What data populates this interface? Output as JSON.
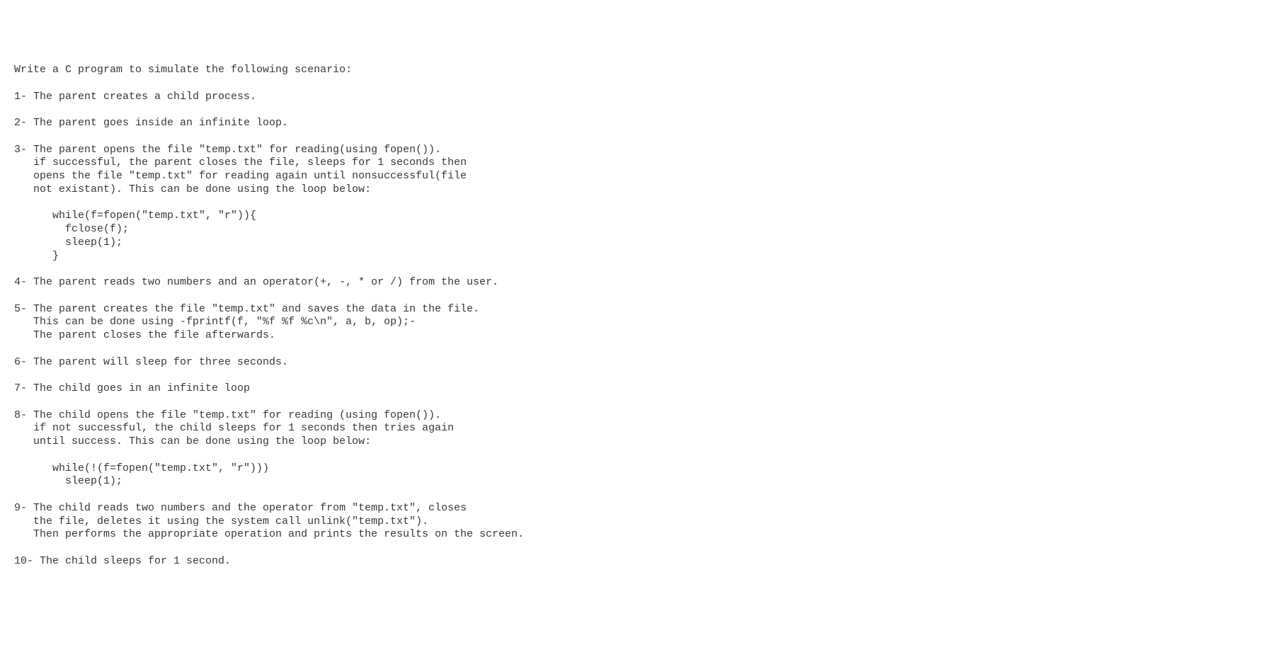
{
  "document": {
    "title": "Write a C program to simulate the following scenario:",
    "blank1": "",
    "step1": "1- The parent creates a child process.",
    "blank2": "",
    "step2": "2- The parent goes inside an infinite loop.",
    "blank3": "",
    "step3_line1": "3- The parent opens the file \"temp.txt\" for reading(using fopen()).",
    "step3_line2": "   if successful, the parent closes the file, sleeps for 1 seconds then",
    "step3_line3": "   opens the file \"temp.txt\" for reading again until nonsuccessful(file",
    "step3_line4": "   not existant). This can be done using the loop below:",
    "blank4": "",
    "step3_code1": "      while(f=fopen(\"temp.txt\", \"r\")){",
    "step3_code2": "        fclose(f);",
    "step3_code3": "        sleep(1);",
    "step3_code4": "      }",
    "blank5": "",
    "step4": "4- The parent reads two numbers and an operator(+, -, * or /) from the user.",
    "blank6": "",
    "step5_line1": "5- The parent creates the file \"temp.txt\" and saves the data in the file.",
    "step5_line2": "   This can be done using -fprintf(f, \"%f %f %c\\n\", a, b, op);-",
    "step5_line3": "   The parent closes the file afterwards.",
    "blank7": "",
    "step6": "6- The parent will sleep for three seconds.",
    "blank8": "",
    "step7": "7- The child goes in an infinite loop",
    "blank9": "",
    "step8_line1": "8- The child opens the file \"temp.txt\" for reading (using fopen()).",
    "step8_line2": "   if not successful, the child sleeps for 1 seconds then tries again",
    "step8_line3": "   until success. This can be done using the loop below:",
    "blank10": "",
    "step8_code1": "      while(!(f=fopen(\"temp.txt\", \"r\")))",
    "step8_code2": "        sleep(1);",
    "blank11": "",
    "step9_line1": "9- The child reads two numbers and the operator from \"temp.txt\", closes",
    "step9_line2": "   the file, deletes it using the system call unlink(\"temp.txt\").",
    "step9_line3": "   Then performs the appropriate operation and prints the results on the screen.",
    "blank12": "",
    "step10": "10- The child sleeps for 1 second."
  }
}
